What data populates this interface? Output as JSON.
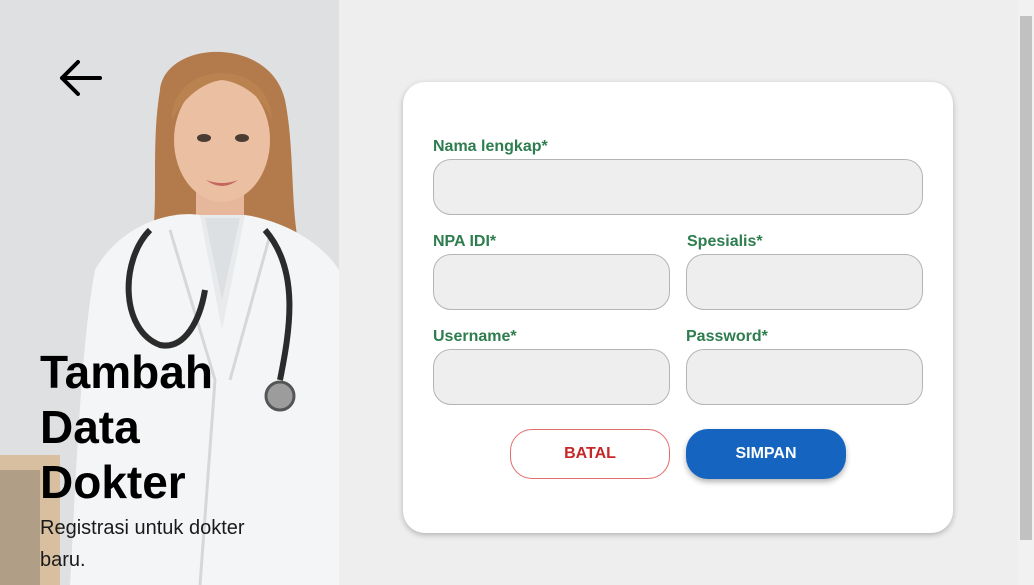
{
  "hero": {
    "title_lines": [
      "Tambah",
      "Data",
      "Dokter"
    ],
    "subtitle": "Registrasi untuk dokter baru."
  },
  "form": {
    "fields": {
      "nama": {
        "label": "Nama lengkap*",
        "value": "",
        "placeholder": ""
      },
      "npa": {
        "label": "NPA IDI*",
        "value": "",
        "placeholder": ""
      },
      "spesialis": {
        "label": "Spesialis*",
        "value": "",
        "placeholder": ""
      },
      "username": {
        "label": "Username*",
        "value": "",
        "placeholder": ""
      },
      "password": {
        "label": "Password*",
        "value": "",
        "placeholder": ""
      }
    },
    "buttons": {
      "cancel": "BATAL",
      "save": "SIMPAN"
    }
  },
  "icons": {
    "back": "arrow-left-icon"
  },
  "colors": {
    "label": "#2e7d4f",
    "save_button": "#1565c0",
    "cancel_text": "#c62828",
    "cancel_border": "#e06d6d",
    "page_background": "#eeeeee"
  }
}
